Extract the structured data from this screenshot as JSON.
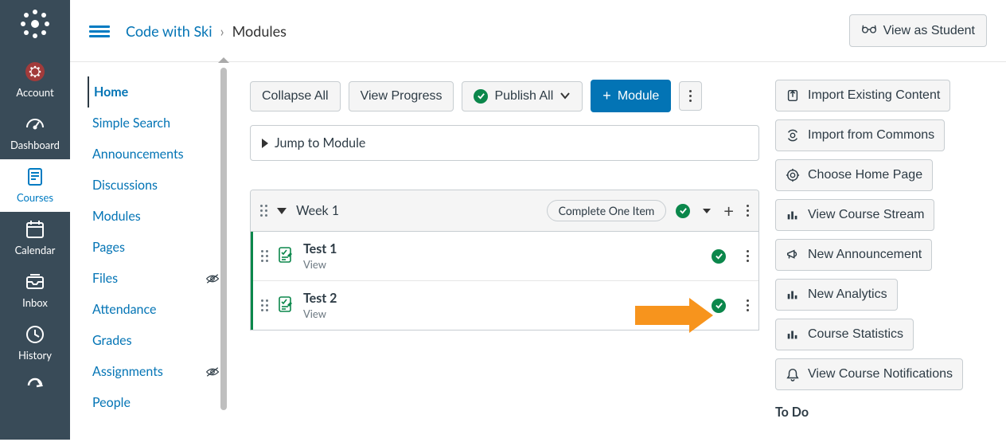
{
  "global_nav": {
    "items": [
      {
        "label": "Account"
      },
      {
        "label": "Dashboard"
      },
      {
        "label": "Courses"
      },
      {
        "label": "Calendar"
      },
      {
        "label": "Inbox"
      },
      {
        "label": "History"
      }
    ]
  },
  "breadcrumbs": {
    "course": "Code with Ski",
    "sep": "›",
    "current": "Modules"
  },
  "top_actions": {
    "view_as_student": "View as Student"
  },
  "course_nav": {
    "home": "Home",
    "items": [
      {
        "label": "Simple Search"
      },
      {
        "label": "Announcements"
      },
      {
        "label": "Discussions"
      },
      {
        "label": "Modules"
      },
      {
        "label": "Pages"
      },
      {
        "label": "Files",
        "hidden": true
      },
      {
        "label": "Attendance"
      },
      {
        "label": "Grades"
      },
      {
        "label": "Assignments",
        "hidden": true
      },
      {
        "label": "People"
      }
    ]
  },
  "toolbar": {
    "collapse_all": "Collapse All",
    "view_progress": "View Progress",
    "publish_all": "Publish All",
    "add_module": "Module",
    "jump_to": "Jump to Module"
  },
  "module": {
    "title": "Week 1",
    "requirement": "Complete One Item",
    "items": [
      {
        "title": "Test 1",
        "sub": "View"
      },
      {
        "title": "Test 2",
        "sub": "View"
      }
    ]
  },
  "right_sidebar": {
    "buttons": [
      "Import Existing Content",
      "Import from Commons",
      "Choose Home Page",
      "View Course Stream",
      "New Announcement",
      "New Analytics",
      "Course Statistics",
      "View Course Notifications"
    ],
    "todo_heading": "To Do"
  },
  "colors": {
    "primary_blue": "#0374b5",
    "nav_bg": "#394b58",
    "green": "#0b874b",
    "pointer": "#f7941d"
  }
}
